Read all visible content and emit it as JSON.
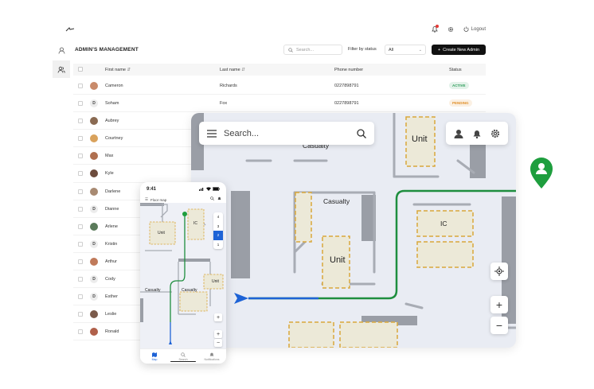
{
  "admin": {
    "title": "ADMIN'S MANAGEMENT",
    "logout_label": "Logout",
    "search_placeholder": "Search...",
    "filter_label": "Filter by status",
    "filter_value": "All",
    "create_button": "Create New Admin",
    "columns": [
      "First name",
      "Last name",
      "Phone number",
      "Status"
    ],
    "rows": [
      {
        "first": "Cameron",
        "last": "Richards",
        "phone": "0227898791",
        "status": "ACTIVE",
        "avatar": "photo"
      },
      {
        "first": "Soham",
        "last": "Fox",
        "phone": "0227898791",
        "status": "PENDING",
        "avatar": "D"
      },
      {
        "first": "Aubrey",
        "last": "",
        "phone": "",
        "status": "",
        "avatar": "photo"
      },
      {
        "first": "Courtney",
        "last": "",
        "phone": "",
        "status": "",
        "avatar": "photo"
      },
      {
        "first": "Max",
        "last": "",
        "phone": "",
        "status": "",
        "avatar": "photo"
      },
      {
        "first": "Kyle",
        "last": "",
        "phone": "",
        "status": "",
        "avatar": "photo"
      },
      {
        "first": "Darlene",
        "last": "",
        "phone": "",
        "status": "",
        "avatar": "photo"
      },
      {
        "first": "Dianne",
        "last": "",
        "phone": "",
        "status": "",
        "avatar": "D"
      },
      {
        "first": "Arlene",
        "last": "",
        "phone": "",
        "status": "",
        "avatar": "photo"
      },
      {
        "first": "Kristin",
        "last": "",
        "phone": "",
        "status": "",
        "avatar": "D"
      },
      {
        "first": "Arthur",
        "last": "",
        "phone": "",
        "status": "",
        "avatar": "photo"
      },
      {
        "first": "Cody",
        "last": "",
        "phone": "",
        "status": "",
        "avatar": "D"
      },
      {
        "first": "Esther",
        "last": "",
        "phone": "",
        "status": "",
        "avatar": "D"
      },
      {
        "first": "Leslie",
        "last": "",
        "phone": "",
        "status": "",
        "avatar": "photo"
      },
      {
        "first": "Ronald",
        "last": "",
        "phone": "",
        "status": "",
        "avatar": "photo"
      }
    ],
    "status_colors": {
      "ACTIVE": "#2e9e5b",
      "PENDING": "#e0902a"
    }
  },
  "map": {
    "search_placeholder": "Search...",
    "labels": {
      "casualty_top": "Casualty",
      "unit_top": "Unit",
      "casualty_mid": "Casualty",
      "unit_mid": "Unit",
      "ic": "IC"
    },
    "zoom_in": "+",
    "zoom_out": "−",
    "route_color": "#1e8e3e",
    "route_start_color": "#1e63d6",
    "icons": [
      "menu-icon",
      "search-icon",
      "user-icon",
      "bell-icon",
      "gear-icon",
      "locate-icon",
      "user-pin-icon"
    ]
  },
  "phone": {
    "time": "9:41",
    "header": "Floor map",
    "floors": [
      "4",
      "3",
      "2",
      "1"
    ],
    "selected_floor": "2",
    "labels": {
      "unit_a": "Unit",
      "ic": "IC",
      "casualty_left": "Casualty",
      "casualty_mid": "Casualty",
      "unit_b": "Unit"
    },
    "nav": [
      "Map",
      "Search",
      "Notifications"
    ],
    "plus": "+",
    "minus": "−"
  }
}
